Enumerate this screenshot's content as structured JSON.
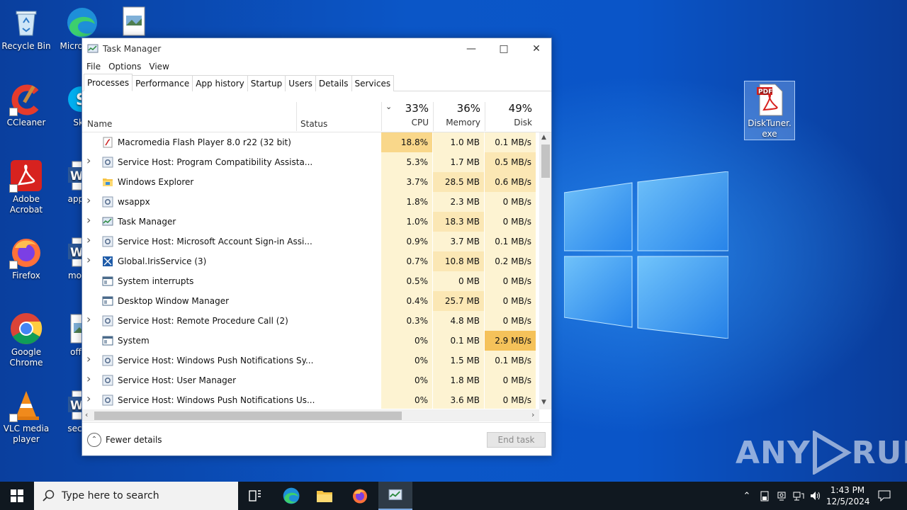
{
  "desktop": {
    "icons": [
      {
        "label": "Recycle Bin"
      },
      {
        "label": "Micro Edg"
      },
      {
        "label": "CCleaner"
      },
      {
        "label": "Sky"
      },
      {
        "label": "Adobe Acrobat"
      },
      {
        "label": "applie"
      },
      {
        "label": "Firefox"
      },
      {
        "label": "motor"
      },
      {
        "label": "Google Chrome"
      },
      {
        "label": "offall"
      },
      {
        "label": "VLC media player"
      },
      {
        "label": "sector"
      },
      {
        "label": "DiskTuner.exe"
      }
    ],
    "pdf_badge": "PDF"
  },
  "task_manager": {
    "title": "Task Manager",
    "menu": [
      "File",
      "Options",
      "View"
    ],
    "tabs": [
      "Processes",
      "Performance",
      "App history",
      "Startup",
      "Users",
      "Details",
      "Services"
    ],
    "active_tab": "Processes",
    "columns": {
      "name": "Name",
      "status": "Status",
      "cpu": {
        "pct": "33%",
        "label": "CPU"
      },
      "memory": {
        "pct": "36%",
        "label": "Memory"
      },
      "disk": {
        "pct": "49%",
        "label": "Disk"
      }
    },
    "processes": [
      {
        "name": "Macromedia Flash Player 8.0  r22 (32 bit)",
        "cpu": "18.8%",
        "memory": "1.0 MB",
        "disk": "0.1 MB/s",
        "expandable": false,
        "icon": "flash-icon"
      },
      {
        "name": "Service Host: Program Compatibility Assista...",
        "cpu": "5.3%",
        "memory": "1.7 MB",
        "disk": "0.5 MB/s",
        "expandable": true,
        "icon": "gear-icon"
      },
      {
        "name": "Windows Explorer",
        "cpu": "3.7%",
        "memory": "28.5 MB",
        "disk": "0.6 MB/s",
        "expandable": false,
        "icon": "folder-icon"
      },
      {
        "name": "wsappx",
        "cpu": "1.8%",
        "memory": "2.3 MB",
        "disk": "0 MB/s",
        "expandable": true,
        "icon": "gear-icon"
      },
      {
        "name": "Task Manager",
        "cpu": "1.0%",
        "memory": "18.3 MB",
        "disk": "0 MB/s",
        "expandable": true,
        "icon": "task-manager-icon"
      },
      {
        "name": "Service Host: Microsoft Account Sign-in Assi...",
        "cpu": "0.9%",
        "memory": "3.7 MB",
        "disk": "0.1 MB/s",
        "expandable": true,
        "icon": "gear-icon"
      },
      {
        "name": "Global.IrisService (3)",
        "cpu": "0.7%",
        "memory": "10.8 MB",
        "disk": "0.2 MB/s",
        "expandable": true,
        "icon": "iris-icon"
      },
      {
        "name": "System interrupts",
        "cpu": "0.5%",
        "memory": "0 MB",
        "disk": "0 MB/s",
        "expandable": false,
        "icon": "window-icon"
      },
      {
        "name": "Desktop Window Manager",
        "cpu": "0.4%",
        "memory": "25.7 MB",
        "disk": "0 MB/s",
        "expandable": false,
        "icon": "window-icon"
      },
      {
        "name": "Service Host: Remote Procedure Call (2)",
        "cpu": "0.3%",
        "memory": "4.8 MB",
        "disk": "0 MB/s",
        "expandable": true,
        "icon": "gear-icon"
      },
      {
        "name": "System",
        "cpu": "0%",
        "memory": "0.1 MB",
        "disk": "2.9 MB/s",
        "expandable": false,
        "icon": "window-icon"
      },
      {
        "name": "Service Host: Windows Push Notifications Sy...",
        "cpu": "0%",
        "memory": "1.5 MB",
        "disk": "0.1 MB/s",
        "expandable": true,
        "icon": "gear-icon"
      },
      {
        "name": "Service Host: User Manager",
        "cpu": "0%",
        "memory": "1.8 MB",
        "disk": "0 MB/s",
        "expandable": true,
        "icon": "gear-icon"
      },
      {
        "name": "Service Host: Windows Push Notifications Us...",
        "cpu": "0%",
        "memory": "3.6 MB",
        "disk": "0 MB/s",
        "expandable": true,
        "icon": "gear-icon"
      }
    ],
    "footer": {
      "fewer_details": "Fewer details",
      "end_task": "End task"
    }
  },
  "taskbar": {
    "search_placeholder": "Type here to search",
    "time": "1:43 PM",
    "date": "12/5/2024"
  },
  "watermark": {
    "left": "ANY",
    "right": "RUN"
  },
  "colors": {
    "heat_high": "#f9d78a",
    "heat_mid": "#fbe7b4",
    "heat_low": "#fdf3d2",
    "heat_disk_hot": "#f5c25a",
    "accent": "#0078d7"
  }
}
